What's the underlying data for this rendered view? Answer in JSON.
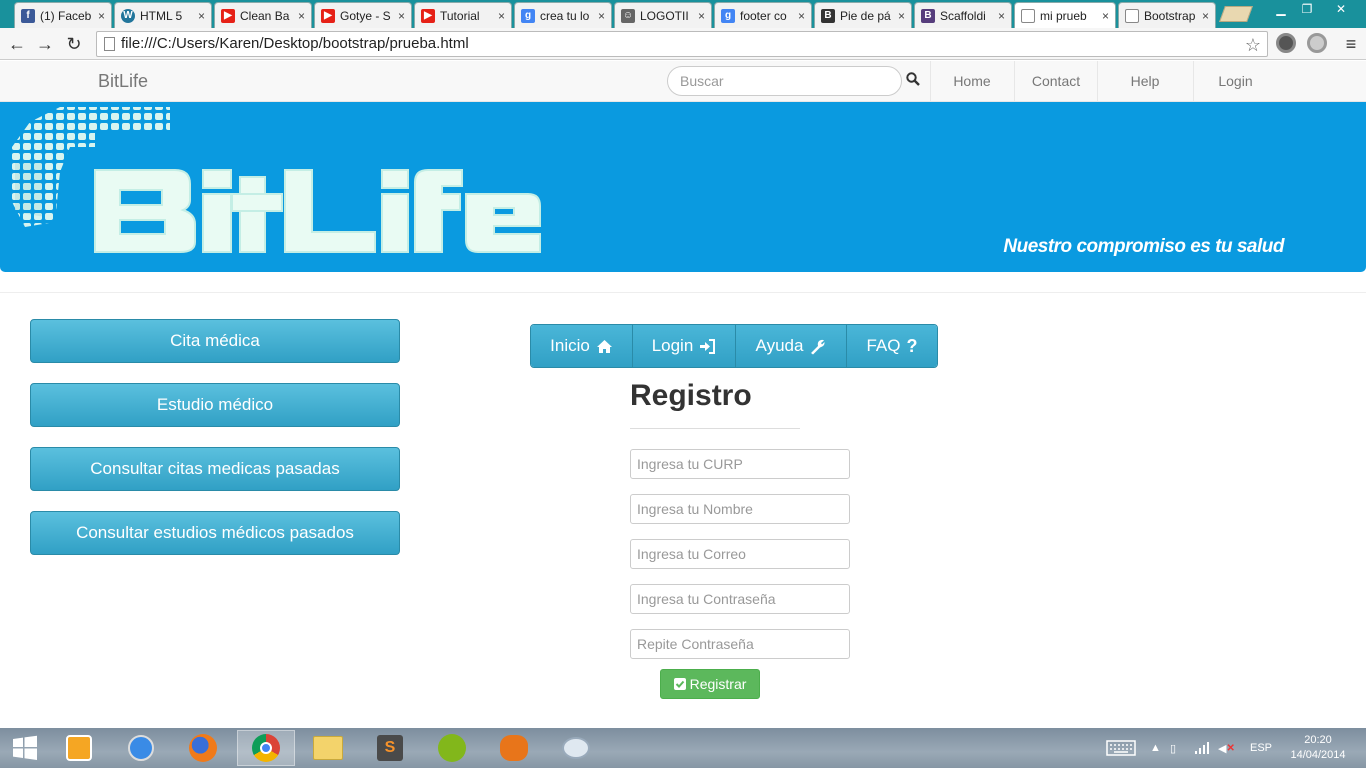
{
  "browser": {
    "tabs": [
      {
        "title": "(1) Faceb",
        "icon": "facebook-icon",
        "color": "#3b5998",
        "glyph": "f"
      },
      {
        "title": "HTML 5",
        "icon": "wordpress-icon",
        "color": "#21759b",
        "glyph": "W"
      },
      {
        "title": "Clean Ba",
        "icon": "youtube-icon",
        "color": "#e62117",
        "glyph": "▶"
      },
      {
        "title": "Gotye - S",
        "icon": "youtube-icon",
        "color": "#e62117",
        "glyph": "▶"
      },
      {
        "title": "Tutorial",
        "icon": "youtube-icon",
        "color": "#e62117",
        "glyph": "▶"
      },
      {
        "title": "crea tu lo",
        "icon": "google-icon",
        "color": "#4285f4",
        "glyph": "g"
      },
      {
        "title": "LOGOTII",
        "icon": "page-favicon-icon",
        "color": "#666666",
        "glyph": "☺"
      },
      {
        "title": "footer co",
        "icon": "google-icon",
        "color": "#4285f4",
        "glyph": "g"
      },
      {
        "title": "Pie de pá",
        "icon": "bootstrap-icon",
        "color": "#333333",
        "glyph": "B"
      },
      {
        "title": "Scaffoldi",
        "icon": "bootstrap-icon",
        "color": "#563d7c",
        "glyph": "B"
      },
      {
        "title": "mi prueb",
        "icon": "document-icon",
        "color": "#ffffff",
        "glyph": ""
      },
      {
        "title": "Bootstrap",
        "icon": "document-icon",
        "color": "#ffffff",
        "glyph": ""
      }
    ],
    "close_glyph": "×",
    "url": "file:///C:/Users/Karen/Desktop/bootstrap/prueba.html"
  },
  "navbar": {
    "brand": "BitLife",
    "search_placeholder": "Buscar",
    "links": [
      "Home",
      "Contact",
      "Help",
      "Login"
    ]
  },
  "banner": {
    "logo_text": "BitLife",
    "tagline": "Nuestro compromiso es tu salud",
    "background": "#0a9ae0"
  },
  "sidebar": {
    "buttons": [
      "Cita médica",
      "Estudio médico",
      "Consultar citas medicas pasadas",
      "Consultar estudios médicos pasados"
    ]
  },
  "menu": {
    "items": [
      {
        "label": "Inicio",
        "icon": "home-icon"
      },
      {
        "label": "Login",
        "icon": "sign-in-icon"
      },
      {
        "label": "Ayuda",
        "icon": "wrench-icon"
      },
      {
        "label": "FAQ",
        "icon": "question-icon"
      }
    ]
  },
  "form": {
    "title": "Registro",
    "fields": [
      {
        "placeholder": "Ingresa tu CURP"
      },
      {
        "placeholder": "Ingresa tu Nombre"
      },
      {
        "placeholder": "Ingresa tu Correo"
      },
      {
        "placeholder": "Ingresa tu Contraseña"
      },
      {
        "placeholder": "Repite Contraseña"
      }
    ],
    "submit_label": "Registrar"
  },
  "taskbar": {
    "language": "ESP",
    "time": "20:20",
    "date": "14/04/2014",
    "apps": [
      "windows-media-player-icon",
      "safari-icon",
      "firefox-icon",
      "chrome-icon",
      "file-explorer-icon",
      "sublime-text-icon",
      "spotify-icon",
      "vlc-remote-icon",
      "paint-icon"
    ]
  }
}
